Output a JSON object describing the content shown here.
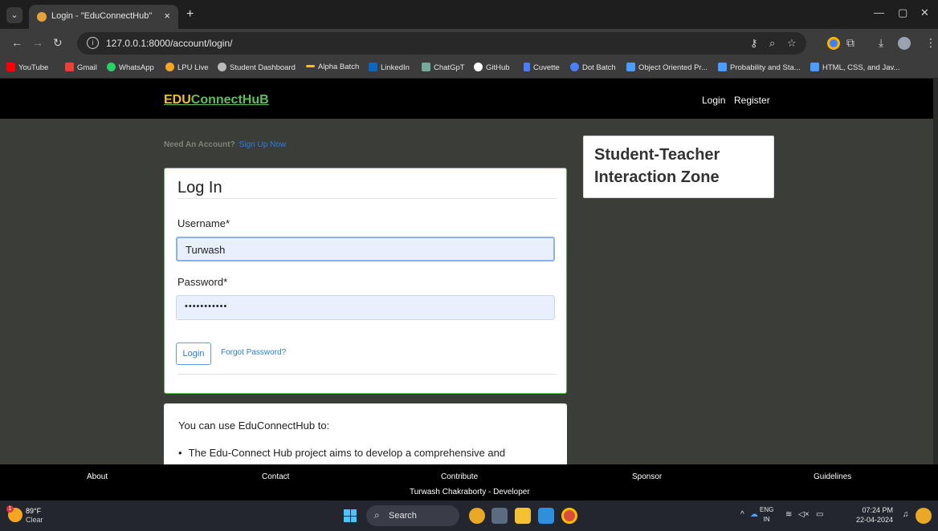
{
  "browser": {
    "tab_title": "Login - \"EduConnectHub\"",
    "tab_close": "×",
    "new_tab": "+",
    "url": "127.0.0.1:8000/account/login/",
    "window_minimize": "—",
    "window_restore": "▢",
    "window_close": "✕"
  },
  "bookmarks": [
    {
      "label": "YouTube",
      "color": "#ff0000"
    },
    {
      "label": "Gmail",
      "color": "#ea4335"
    },
    {
      "label": "WhatsApp",
      "color": "#25d366"
    },
    {
      "label": "LPU Live",
      "color": "#f5a623"
    },
    {
      "label": "Student Dashboard",
      "color": "#bbbbbb"
    },
    {
      "label": "Alpha Batch",
      "color": "#f3c21b"
    },
    {
      "label": "LinkedIn",
      "color": "#0a66c2"
    },
    {
      "label": "ChatGpT",
      "color": "#74aa9c"
    },
    {
      "label": "GitHub",
      "color": "#ffffff"
    },
    {
      "label": "Cuvette",
      "color": "#4a7dff"
    },
    {
      "label": "Dot Batch",
      "color": "#4a7dff"
    },
    {
      "label": "Object Oriented Pr...",
      "color": "#4a9dff"
    },
    {
      "label": "Probability and Sta...",
      "color": "#4a9dff"
    },
    {
      "label": "HTML, CSS, and Jav...",
      "color": "#4a9dff"
    }
  ],
  "site": {
    "brand_prefix": "EDU",
    "brand_suffix": "ConnectHuB",
    "nav_login": "Login",
    "nav_register": "Register",
    "need_account": "Need An Account?",
    "sign_up": "Sign Up Now",
    "zone_title": "Student-Teacher Interaction Zone"
  },
  "login_form": {
    "title": "Log In",
    "username_label": "Username*",
    "username_value": "Turwash",
    "password_label": "Password*",
    "password_value": "•••••••••••",
    "login_button": "Login",
    "forgot_link": "Forgot Password?"
  },
  "info": {
    "intro": "You can use EduConnectHub to:",
    "bullet_1": "The Edu-Connect Hub project aims to develop a comprehensive and"
  },
  "footer": {
    "about": "About",
    "contact": "Contact",
    "contribute": "Contribute",
    "sponsor": "Sponsor",
    "guidelines": "Guidelines",
    "credit": "Turwash Chakraborty - Developer"
  },
  "taskbar": {
    "weather_badge": "1",
    "temperature": "89°F",
    "weather": "Clear",
    "search": "Search",
    "lang_1": "ENG",
    "lang_2": "IN",
    "time": "07:24 PM",
    "date": "22-04-2024"
  }
}
